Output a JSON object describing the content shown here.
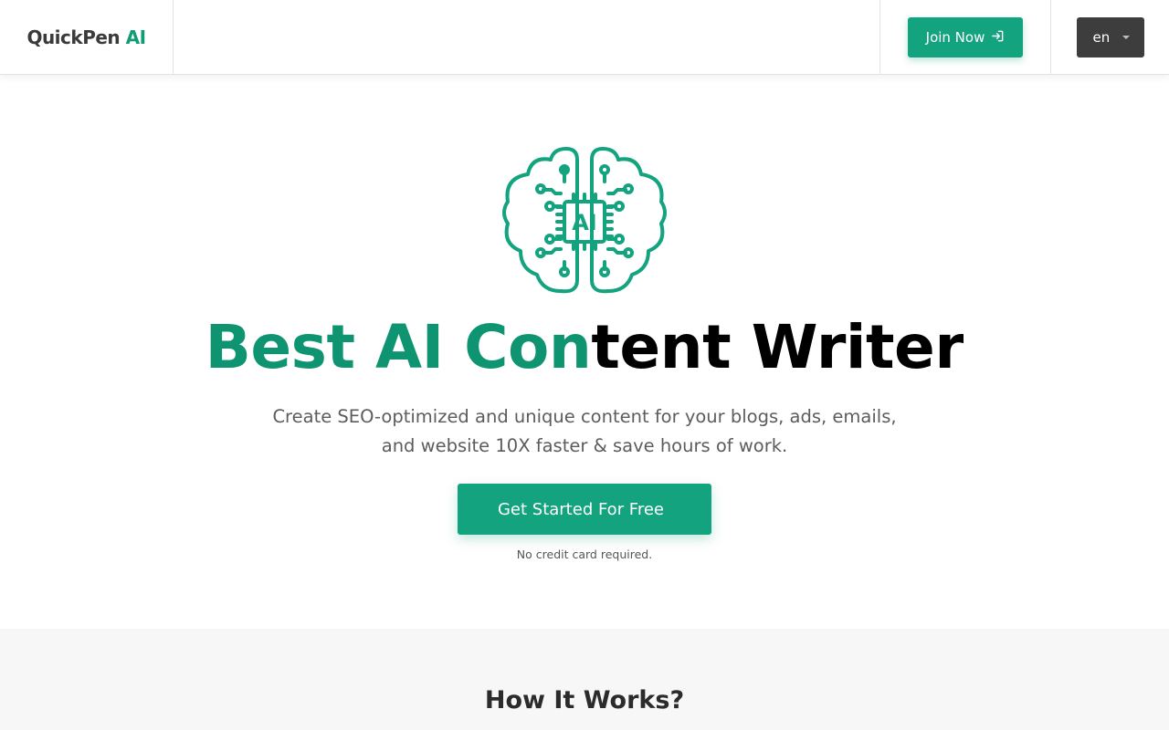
{
  "header": {
    "logo": {
      "name": "QuickPen",
      "accent": "AI"
    },
    "join_label": "Join Now",
    "join_icon": "sign-in-icon",
    "language": "en"
  },
  "hero": {
    "icon": "ai-brain-chip-icon",
    "chip_label": "AI",
    "title": "Best AI Content Writer",
    "subtitle_line1": "Create SEO-optimized and unique content for your blogs, ads, emails,",
    "subtitle_line2": "and website 10X faster & save hours of work.",
    "cta_label": "Get Started For Free",
    "cta_note": "No credit card required."
  },
  "how_it_works": {
    "title": "How It Works?"
  },
  "colors": {
    "brand_green": "#14a37f",
    "title_green": "#0e9470",
    "dark_button": "#3d3d3d",
    "section_bg": "#f7f7f7"
  }
}
